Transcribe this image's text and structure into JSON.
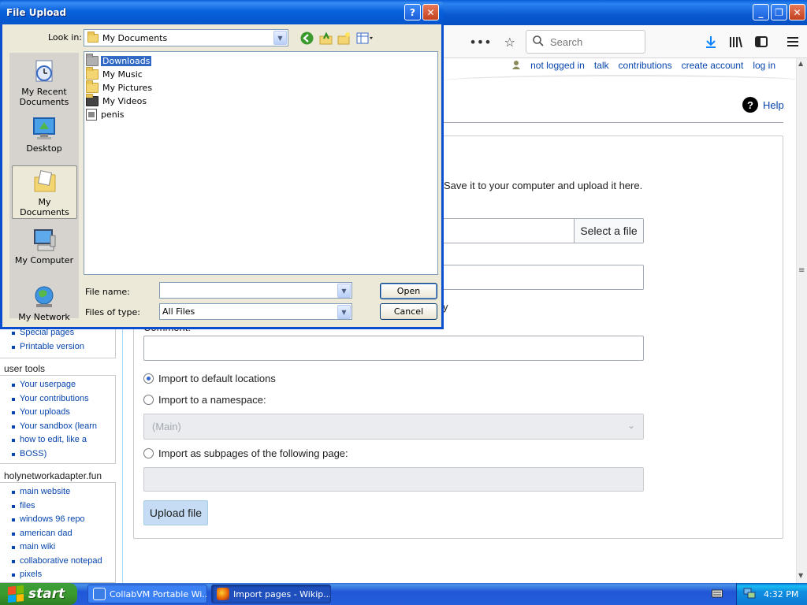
{
  "browser": {
    "search_placeholder": "Search",
    "personal": [
      "not logged in",
      "talk",
      "contributions",
      "create account",
      "log in"
    ],
    "help": "Help"
  },
  "page": {
    "intro": "Save it to your computer and upload it here.",
    "select_file": "Select a file",
    "stray_text": "y",
    "comment_label": "Comment:",
    "radio_default": "Import to default locations",
    "radio_namespace": "Import to a namespace:",
    "namespace_value": "(Main)",
    "radio_subpages": "Import as subpages of the following page:",
    "upload_button": "Upload file"
  },
  "sidebar": {
    "tools_items": [
      "Special pages",
      "Printable version"
    ],
    "user_tools_heading": "user tools",
    "user_tools_items": [
      "Your userpage",
      "Your contributions",
      "Your uploads",
      "Your sandbox (learn",
      "how to edit, like a",
      "BOSS)"
    ],
    "site_heading": "holynetworkadapter.fun",
    "site_items": [
      "main website",
      "files",
      "windows 96 repo",
      "american dad",
      "main wiki",
      "collaborative notepad",
      "pixels"
    ]
  },
  "dialog": {
    "title": "File Upload",
    "look_in_label": "Look in:",
    "look_in_value": "My Documents",
    "places": [
      "My Recent Documents",
      "Desktop",
      "My Documents",
      "My Computer",
      "My Network"
    ],
    "files": [
      "Downloads",
      "My Music",
      "My Pictures",
      "My Videos",
      "penis"
    ],
    "file_name_label": "File name:",
    "file_name_value": "",
    "files_of_type_label": "Files of type:",
    "files_of_type_value": "All Files",
    "open_button": "Open",
    "cancel_button": "Cancel"
  },
  "taskbar": {
    "start_label": "start",
    "tasks": [
      "CollabVM Portable Wi...",
      "Import pages - Wikip..."
    ],
    "clock": "4:32 PM"
  },
  "colors": {
    "xp_blue": "#245edb",
    "link_blue": "#0645ad",
    "selection": "#316ac5"
  }
}
